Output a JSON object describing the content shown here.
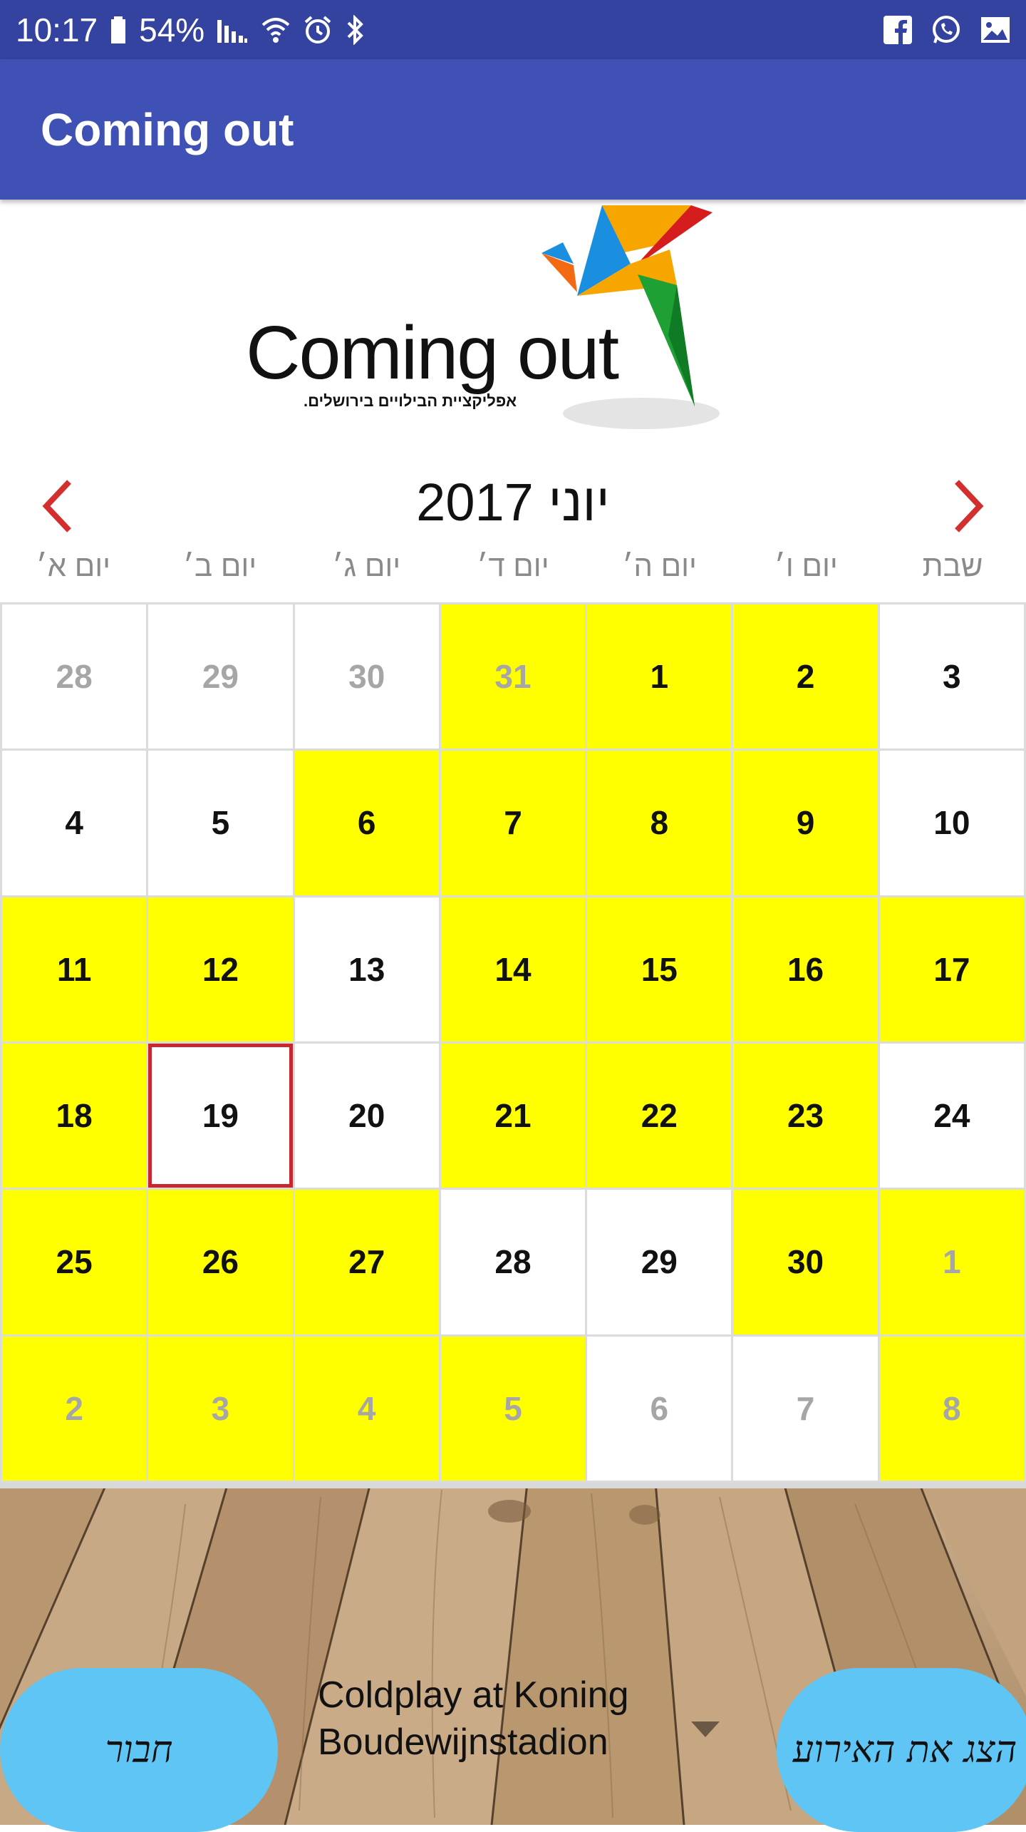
{
  "status_bar": {
    "time": "10:17",
    "battery": "54%",
    "left_icons": [
      "battery-icon",
      "signal-icon",
      "wifi-icon",
      "alarm-icon",
      "bluetooth-icon"
    ],
    "right_icons": [
      "facebook-icon",
      "whatsapp-icon",
      "image-icon"
    ]
  },
  "app_bar": {
    "title": "Coming out"
  },
  "logo": {
    "text": "Coming out",
    "subtitle": "אפליקציית הבילויים בירושלים."
  },
  "calendar": {
    "month_title": "יוני 2017",
    "weekdays": [
      "יום א׳",
      "יום ב׳",
      "יום ג׳",
      "יום ד׳",
      "יום ה׳",
      "יום ו׳",
      "שבת"
    ],
    "cells": [
      {
        "day": "28",
        "hl": false,
        "muted": true
      },
      {
        "day": "29",
        "hl": false,
        "muted": true
      },
      {
        "day": "30",
        "hl": false,
        "muted": true
      },
      {
        "day": "31",
        "hl": true,
        "muted": true
      },
      {
        "day": "1",
        "hl": true,
        "muted": false
      },
      {
        "day": "2",
        "hl": true,
        "muted": false
      },
      {
        "day": "3",
        "hl": false,
        "muted": false
      },
      {
        "day": "4",
        "hl": false,
        "muted": false
      },
      {
        "day": "5",
        "hl": false,
        "muted": false
      },
      {
        "day": "6",
        "hl": true,
        "muted": false
      },
      {
        "day": "7",
        "hl": true,
        "muted": false
      },
      {
        "day": "8",
        "hl": true,
        "muted": false
      },
      {
        "day": "9",
        "hl": true,
        "muted": false
      },
      {
        "day": "10",
        "hl": false,
        "muted": false
      },
      {
        "day": "11",
        "hl": true,
        "muted": false
      },
      {
        "day": "12",
        "hl": true,
        "muted": false
      },
      {
        "day": "13",
        "hl": false,
        "muted": false
      },
      {
        "day": "14",
        "hl": true,
        "muted": false
      },
      {
        "day": "15",
        "hl": true,
        "muted": false
      },
      {
        "day": "16",
        "hl": true,
        "muted": false
      },
      {
        "day": "17",
        "hl": true,
        "muted": false
      },
      {
        "day": "18",
        "hl": true,
        "muted": false
      },
      {
        "day": "19",
        "hl": false,
        "muted": false,
        "today": true
      },
      {
        "day": "20",
        "hl": false,
        "muted": false
      },
      {
        "day": "21",
        "hl": true,
        "muted": false
      },
      {
        "day": "22",
        "hl": true,
        "muted": false
      },
      {
        "day": "23",
        "hl": true,
        "muted": false
      },
      {
        "day": "24",
        "hl": false,
        "muted": false
      },
      {
        "day": "25",
        "hl": true,
        "muted": false
      },
      {
        "day": "26",
        "hl": true,
        "muted": false
      },
      {
        "day": "27",
        "hl": true,
        "muted": false
      },
      {
        "day": "28",
        "hl": false,
        "muted": false
      },
      {
        "day": "29",
        "hl": false,
        "muted": false
      },
      {
        "day": "30",
        "hl": true,
        "muted": false
      },
      {
        "day": "1",
        "hl": true,
        "muted": true
      },
      {
        "day": "2",
        "hl": true,
        "muted": true
      },
      {
        "day": "3",
        "hl": true,
        "muted": true
      },
      {
        "day": "4",
        "hl": true,
        "muted": true
      },
      {
        "day": "5",
        "hl": true,
        "muted": true
      },
      {
        "day": "6",
        "hl": false,
        "muted": true
      },
      {
        "day": "7",
        "hl": false,
        "muted": true
      },
      {
        "day": "8",
        "hl": true,
        "muted": true
      }
    ]
  },
  "bottom": {
    "left_button": "חבור",
    "right_button": "הצג את האירוע",
    "dropdown_value": "Coldplay at Koning Boudewijnstadion"
  },
  "colors": {
    "status_bar": "#3442a0",
    "app_bar": "#3f51b5",
    "highlight": "#ffff00",
    "today_border": "#c7272d",
    "nav_arrow": "#d32f2f",
    "button": "#5ec5f5"
  }
}
